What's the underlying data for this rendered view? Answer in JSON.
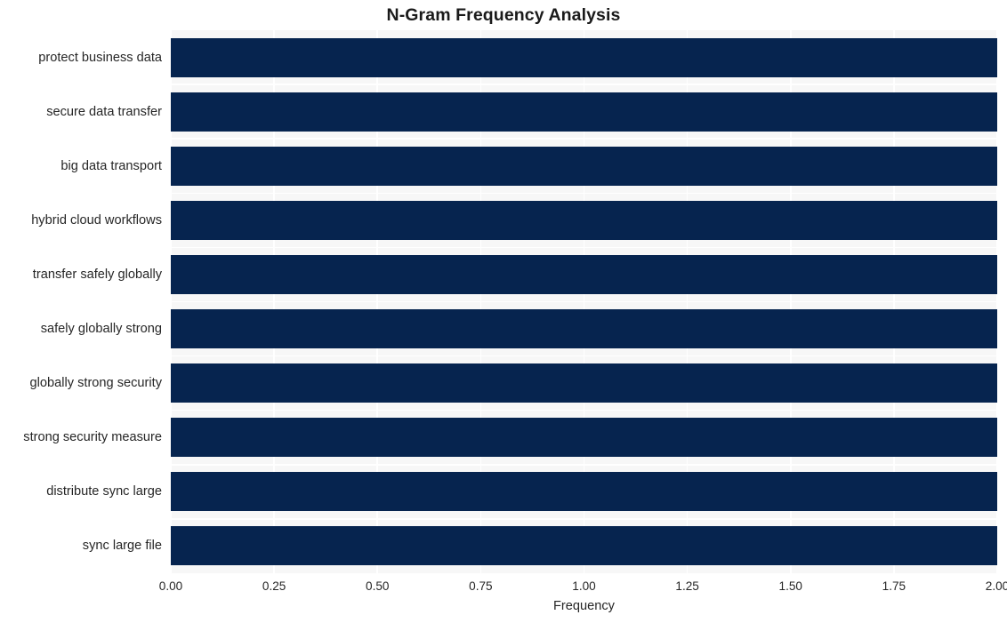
{
  "chart_data": {
    "type": "bar",
    "orientation": "horizontal",
    "title": "N-Gram Frequency Analysis",
    "xlabel": "Frequency",
    "ylabel": "",
    "categories": [
      "protect business data",
      "secure data transfer",
      "big data transport",
      "hybrid cloud workflows",
      "transfer safely globally",
      "safely globally strong",
      "globally strong security",
      "strong security measure",
      "distribute sync large",
      "sync large file"
    ],
    "values": [
      2,
      2,
      2,
      2,
      2,
      2,
      2,
      2,
      2,
      2
    ],
    "xlim": [
      0,
      2
    ],
    "xticks": [
      0,
      0.25,
      0.5,
      0.75,
      1,
      1.25,
      1.5,
      1.75,
      2
    ],
    "xtick_labels": [
      "0.00",
      "0.25",
      "0.50",
      "0.75",
      "1.00",
      "1.25",
      "1.50",
      "1.75",
      "2.00"
    ],
    "grid": true,
    "legend": null,
    "bar_color": "#06244f",
    "plot_background": "#f7f7f7",
    "grid_color": "#ffffff",
    "figure_background": "#ffffff"
  }
}
